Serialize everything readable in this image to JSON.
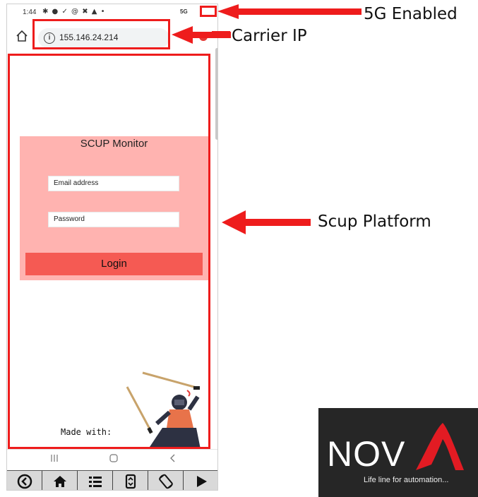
{
  "status_bar": {
    "time": "1:44",
    "icons": "✱ ● ✓ @ ✖ ▲ •",
    "network": "5G"
  },
  "browser": {
    "home_icon": "home-icon",
    "info_icon": "i",
    "url": "155.146.24.214"
  },
  "login_card": {
    "title": "SCUP Monitor",
    "email_placeholder": "Email address",
    "password_placeholder": "Password",
    "login_label": "Login",
    "background": "#ffb3b0",
    "button_color": "#f55a53"
  },
  "footer_text": "Made with:",
  "android_nav": [
    "recents-icon",
    "home-circle-icon",
    "back-icon"
  ],
  "control_bar": [
    "back-circle-icon",
    "home-icon",
    "list-icon",
    "screenshot-icon",
    "rotate-icon",
    "play-icon"
  ],
  "annotations": {
    "five_g": "5G Enabled",
    "carrier_ip": "Carrier IP",
    "platform": "Scup Platform",
    "color": "#ee1c1c"
  },
  "logo": {
    "text_prefix": "NOV",
    "text_accent": "A",
    "tagline": "Life line for automation..."
  }
}
